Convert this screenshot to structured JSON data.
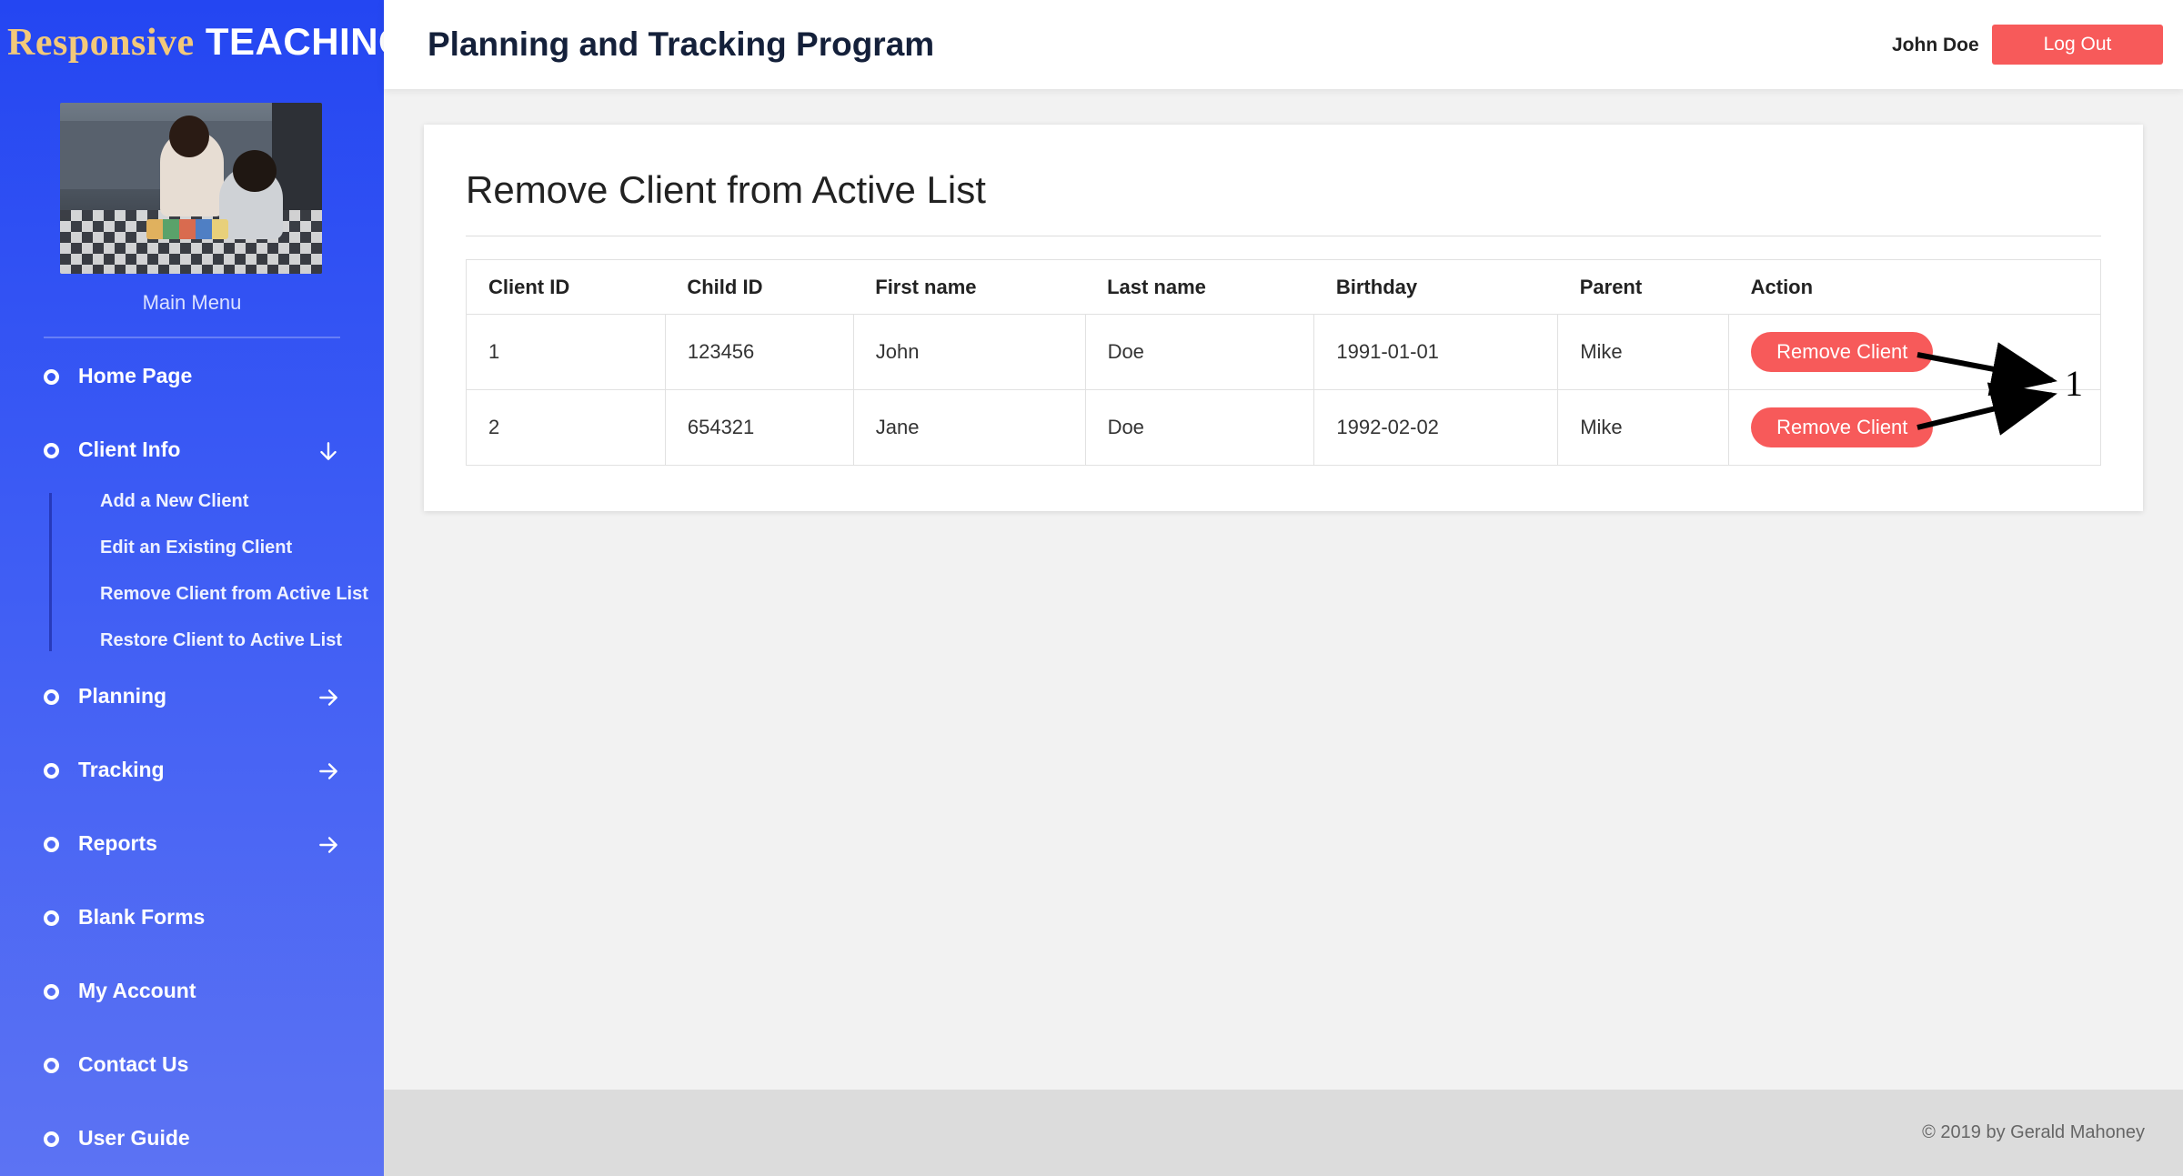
{
  "brand": {
    "part1": "Responsive",
    "part2": "TEACHING"
  },
  "sidebar": {
    "photo_alt": "Children playing with blocks",
    "menu_title": "Main Menu",
    "items": [
      {
        "label": "Home Page"
      },
      {
        "label": "Client Info"
      },
      {
        "label": "Planning"
      },
      {
        "label": "Tracking"
      },
      {
        "label": "Reports"
      },
      {
        "label": "Blank Forms"
      },
      {
        "label": "My Account"
      },
      {
        "label": "Contact Us"
      },
      {
        "label": "User Guide"
      }
    ],
    "client_submenu": [
      {
        "label": "Add a New Client"
      },
      {
        "label": "Edit an Existing Client"
      },
      {
        "label": "Remove Client from Active List"
      },
      {
        "label": "Restore Client to Active List"
      }
    ]
  },
  "header": {
    "title": "Planning and Tracking Program",
    "user_name": "John Doe",
    "logout_label": "Log Out"
  },
  "main": {
    "title": "Remove Client from Active List",
    "table": {
      "columns": [
        "Client ID",
        "Child ID",
        "First name",
        "Last name",
        "Birthday",
        "Parent",
        "Action"
      ],
      "rows": [
        {
          "client_id": "1",
          "child_id": "123456",
          "first_name": "John",
          "last_name": "Doe",
          "birthday": "1991-01-01",
          "parent": "Mike",
          "action": "Remove Client"
        },
        {
          "client_id": "2",
          "child_id": "654321",
          "first_name": "Jane",
          "last_name": "Doe",
          "birthday": "1992-02-02",
          "parent": "Mike",
          "action": "Remove Client"
        }
      ]
    },
    "annotation_number": "1"
  },
  "footer": {
    "copyright": "© 2019 by Gerald Mahoney"
  },
  "colors": {
    "sidebar_top": "#2446f2",
    "sidebar_bottom": "#5c73f3",
    "accent_red": "#f75a5a",
    "brand_gold": "#f3c97a"
  }
}
